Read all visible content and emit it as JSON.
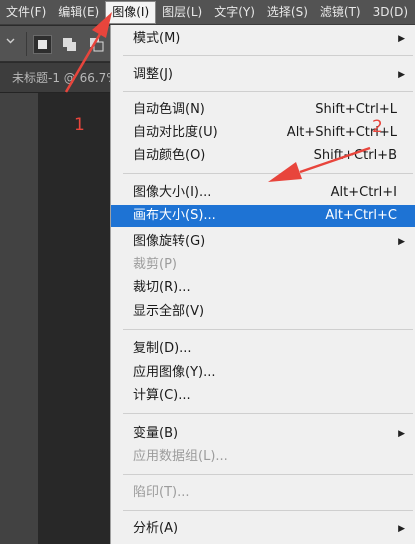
{
  "menubar": {
    "items": [
      {
        "label": "文件(F)",
        "active": false
      },
      {
        "label": "编辑(E)",
        "active": false
      },
      {
        "label": "图像(I)",
        "active": true
      },
      {
        "label": "图层(L)",
        "active": false
      },
      {
        "label": "文字(Y)",
        "active": false
      },
      {
        "label": "选择(S)",
        "active": false
      },
      {
        "label": "滤镜(T)",
        "active": false
      },
      {
        "label": "3D(D)",
        "active": false
      }
    ]
  },
  "document": {
    "tab_title": "未标题-1 @ 66.7%"
  },
  "menu": {
    "mode": {
      "label": "模式(M)"
    },
    "adjust": {
      "label": "调整(J)"
    },
    "auto_tone": {
      "label": "自动色调(N)",
      "shortcut": "Shift+Ctrl+L"
    },
    "auto_contrast": {
      "label": "自动对比度(U)",
      "shortcut": "Alt+Shift+Ctrl+L"
    },
    "auto_color": {
      "label": "自动颜色(O)",
      "shortcut": "Shift+Ctrl+B"
    },
    "image_size": {
      "label": "图像大小(I)...",
      "shortcut": "Alt+Ctrl+I"
    },
    "canvas_size": {
      "label": "画布大小(S)...",
      "shortcut": "Alt+Ctrl+C"
    },
    "rotation": {
      "label": "图像旋转(G)"
    },
    "crop": {
      "label": "裁剪(P)"
    },
    "trim": {
      "label": "裁切(R)..."
    },
    "reveal_all": {
      "label": "显示全部(V)"
    },
    "duplicate": {
      "label": "复制(D)..."
    },
    "apply_image": {
      "label": "应用图像(Y)..."
    },
    "calculations": {
      "label": "计算(C)..."
    },
    "variables": {
      "label": "变量(B)"
    },
    "apply_dataset": {
      "label": "应用数据组(L)..."
    },
    "trap": {
      "label": "陷印(T)..."
    },
    "analysis": {
      "label": "分析(A)"
    }
  },
  "annotations": {
    "step1": "1",
    "step2": "2",
    "color": "#e8453c"
  },
  "colors": {
    "highlight": "#1e73d4",
    "menu_bg": "#f0f0f0",
    "chrome": "#535353"
  }
}
